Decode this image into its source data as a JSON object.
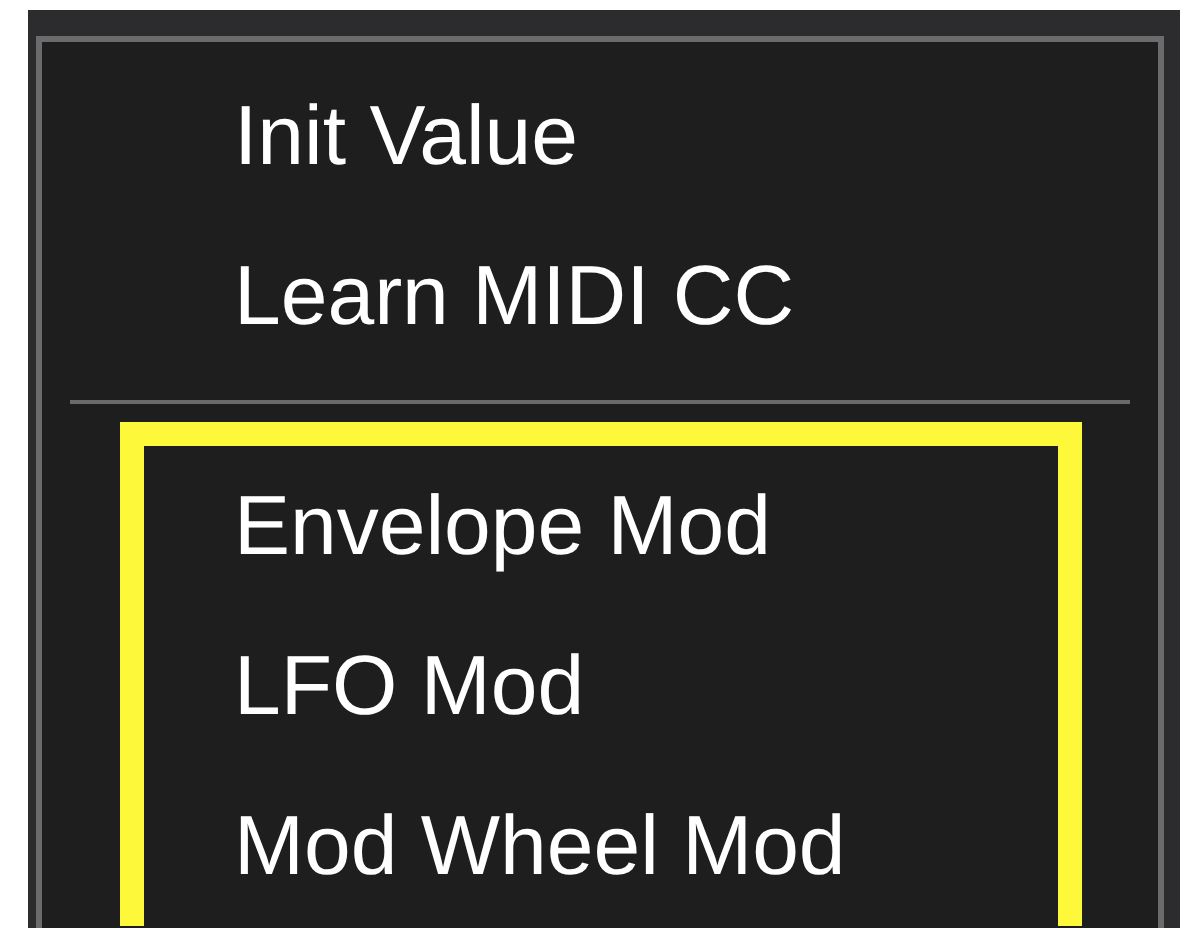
{
  "context_menu": {
    "sections": [
      {
        "highlighted": false,
        "items": [
          {
            "label": "Init Value"
          },
          {
            "label": "Learn MIDI CC"
          }
        ]
      },
      {
        "highlighted": true,
        "items": [
          {
            "label": "Envelope Mod"
          },
          {
            "label": "LFO Mod"
          },
          {
            "label": "Mod Wheel Mod"
          }
        ]
      }
    ]
  }
}
